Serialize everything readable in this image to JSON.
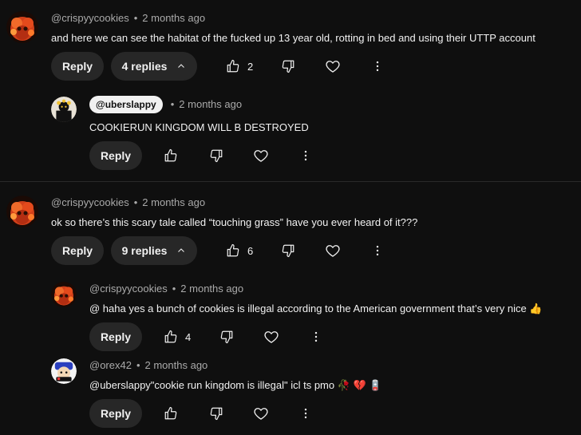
{
  "threads": [
    {
      "author": "@crispyycookies",
      "time": "2 months ago",
      "text": "and here we can see the habitat of the fucked up 13 year old, rotting in bed and using their UTTP account",
      "reply_label": "Reply",
      "replies_label": "4 replies",
      "likes": "2",
      "replies": [
        {
          "author": "@uberslappy",
          "time": "2 months ago",
          "text": "COOKIERUN KINGDOM WILL B DESTROYED",
          "reply_label": "Reply",
          "likes": ""
        }
      ]
    },
    {
      "author": "@crispyycookies",
      "time": "2 months ago",
      "text": "ok so there’s this scary tale called “touching grass” have you ever heard of it???",
      "reply_label": "Reply",
      "replies_label": "9 replies",
      "likes": "6",
      "replies": [
        {
          "author": "@crispyycookies",
          "time": "2 months ago",
          "text": "@ haha yes a bunch of cookies is illegal according to the American government that’s very nice",
          "emoji": "👍",
          "reply_label": "Reply",
          "likes": "4"
        },
        {
          "author": "@orex42",
          "time": "2 months ago",
          "text": "@uberslappy\"cookie run kingdom is illegal\" icl ts pmo",
          "emoji": "🥀 💔 🪫",
          "reply_label": "Reply",
          "likes": ""
        }
      ]
    }
  ],
  "separator": "•",
  "colors": {
    "background": "#0f0f0f",
    "pill": "#272727",
    "meta_text": "#aaaaaa",
    "text": "#f1f1f1"
  }
}
